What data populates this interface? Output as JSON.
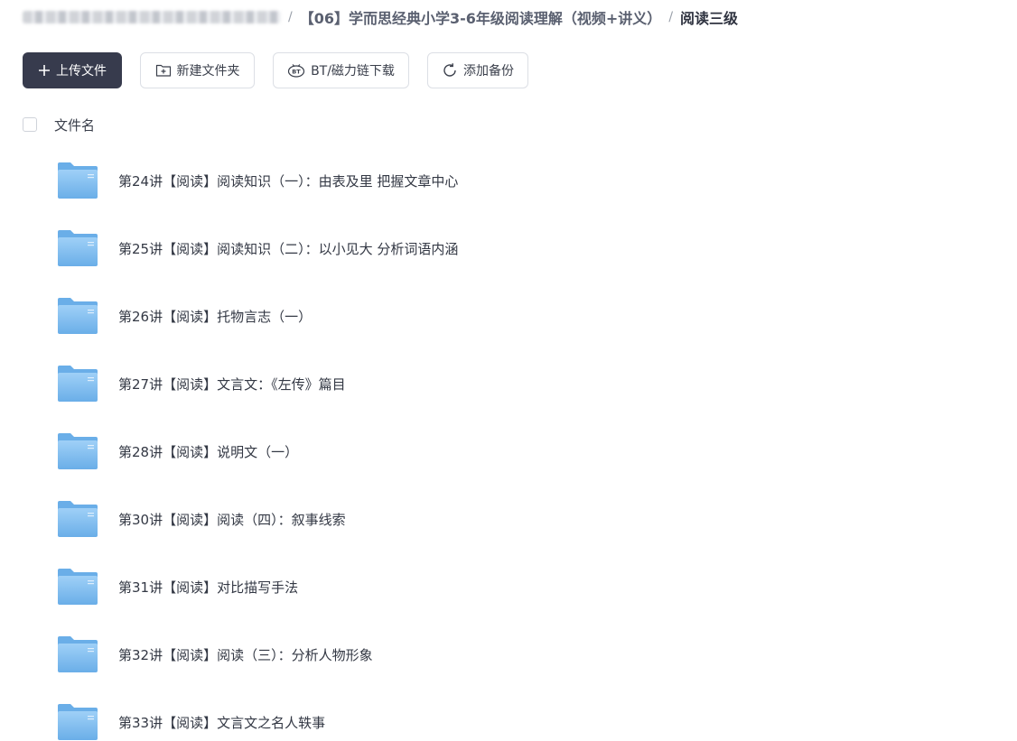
{
  "breadcrumb": {
    "parent_folder": "【06】学而思经典小学3-6年级阅读理解（视频+讲义）",
    "current_folder": "阅读三级",
    "separator": "/"
  },
  "toolbar": {
    "upload_label": "上传文件",
    "new_folder_label": "新建文件夹",
    "bt_download_label": "BT/磁力链下载",
    "add_backup_label": "添加备份"
  },
  "list": {
    "column_name": "文件名",
    "items": [
      {
        "name": "第24讲【阅读】阅读知识（一）：由表及里 把握文章中心",
        "icon": "folder-icon"
      },
      {
        "name": "第25讲【阅读】阅读知识（二）：以小见大 分析词语内涵",
        "icon": "folder-icon"
      },
      {
        "name": "第26讲【阅读】托物言志（一）",
        "icon": "folder-icon"
      },
      {
        "name": "第27讲【阅读】文言文：《左传》篇目",
        "icon": "folder-icon"
      },
      {
        "name": "第28讲【阅读】说明文（一）",
        "icon": "folder-icon"
      },
      {
        "name": "第30讲【阅读】阅读（四）：叙事线索",
        "icon": "folder-icon"
      },
      {
        "name": "第31讲【阅读】对比描写手法",
        "icon": "folder-icon"
      },
      {
        "name": "第32讲【阅读】阅读（三）：分析人物形象",
        "icon": "folder-icon"
      },
      {
        "name": "第33讲【阅读】文言文之名人轶事",
        "icon": "folder-icon"
      }
    ]
  },
  "colors": {
    "primary_button": "#373b4d",
    "folder_blue": "#6aaee8",
    "folder_light": "#9fd0f7"
  }
}
